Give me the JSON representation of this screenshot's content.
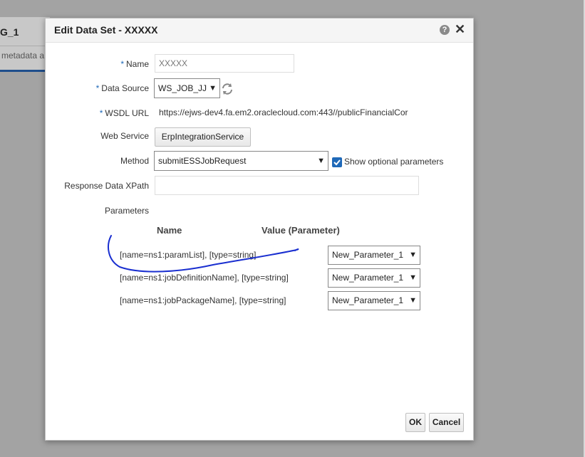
{
  "background": {
    "tab_title": "G_1",
    "tab_text": "metadata a"
  },
  "dialog": {
    "title": "Edit Data Set - XXXXX",
    "help_glyph": "?",
    "close_glyph": "✕",
    "required_marker": "*",
    "fields": {
      "name_label": "Name",
      "name_value": "XXXXX",
      "data_source_label": "Data Source",
      "data_source_value": "WS_JOB_JJ",
      "wsdl_label": "WSDL URL",
      "wsdl_value": "https://ejws-dev4.fa.em2.oraclecloud.com:443//publicFinancialCor",
      "web_service_label": "Web Service",
      "web_service_value": "ErpIntegrationService",
      "method_label": "Method",
      "method_value": "submitESSJobRequest",
      "show_optional_label": "Show optional parameters",
      "show_optional_checked": true,
      "xpath_label": "Response Data XPath",
      "xpath_value": ""
    },
    "parameters": {
      "label": "Parameters",
      "col_name": "Name",
      "col_value": "Value (Parameter)",
      "rows": [
        {
          "name": "[name=ns1:paramList], [type=string]",
          "value": "New_Parameter_1"
        },
        {
          "name": "[name=ns1:jobDefinitionName], [type=string]",
          "value": "New_Parameter_1"
        },
        {
          "name": "[name=ns1:jobPackageName], [type=string]",
          "value": "New_Parameter_1"
        }
      ]
    },
    "buttons": {
      "ok": "OK",
      "cancel": "Cancel"
    }
  },
  "colors": {
    "required_star": "#1f69b8",
    "checkbox": "#1f69b8",
    "annotation_ink": "#1a2fd0"
  }
}
